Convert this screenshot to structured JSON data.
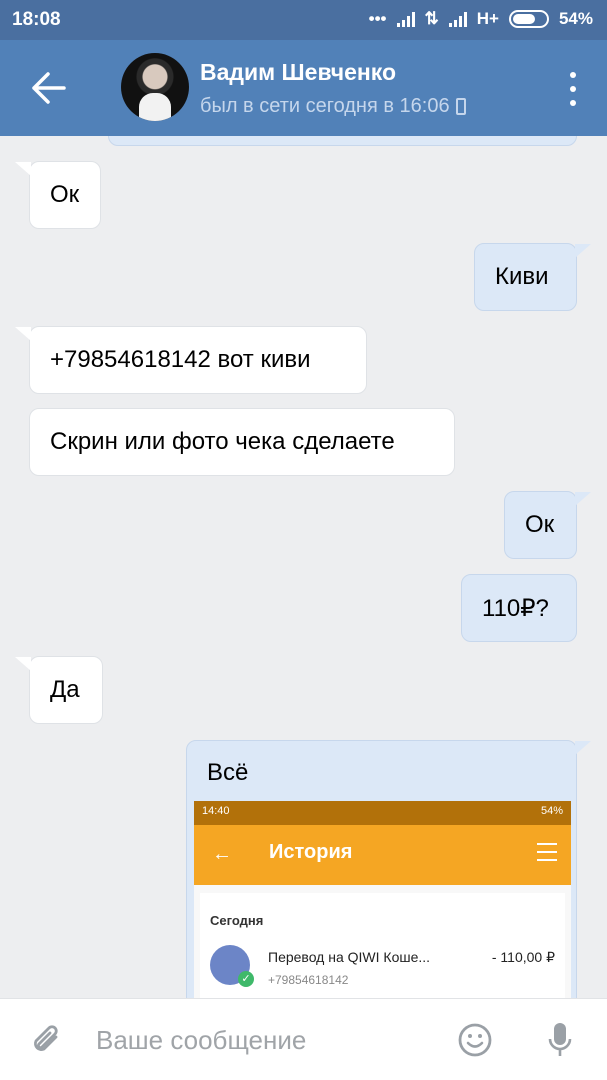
{
  "status_bar": {
    "time": "18:08",
    "network": "H+",
    "battery": "54%"
  },
  "header": {
    "contact_name": "Вадим Шевченко",
    "presence": "был в сети сегодня в 16:06"
  },
  "messages": [
    {
      "direction": "in",
      "text": "Ок"
    },
    {
      "direction": "out",
      "text": "Киви"
    },
    {
      "direction": "in",
      "text": "+79854618142 вот киви"
    },
    {
      "direction": "in",
      "text": "Скрин или фото чека сделаете"
    },
    {
      "direction": "out",
      "text": "Ок"
    },
    {
      "direction": "out",
      "text": "110₽?"
    },
    {
      "direction": "in",
      "text": "Да"
    },
    {
      "direction": "out",
      "text": "Всё"
    }
  ],
  "attachment": {
    "status_time": "14:40",
    "status_battery": "54%",
    "title": "История",
    "section": "Сегодня",
    "transaction": "Перевод на QIWI Коше...",
    "amount": "- 110,00 ₽",
    "phone": "+79854618142"
  },
  "input": {
    "placeholder": "Ваше сообщение"
  },
  "colors": {
    "header": "#5181b8",
    "status_bar": "#4a6fa0",
    "bubble_out": "#dce8f7",
    "bubble_in": "#ffffff",
    "background": "#edeef0"
  }
}
